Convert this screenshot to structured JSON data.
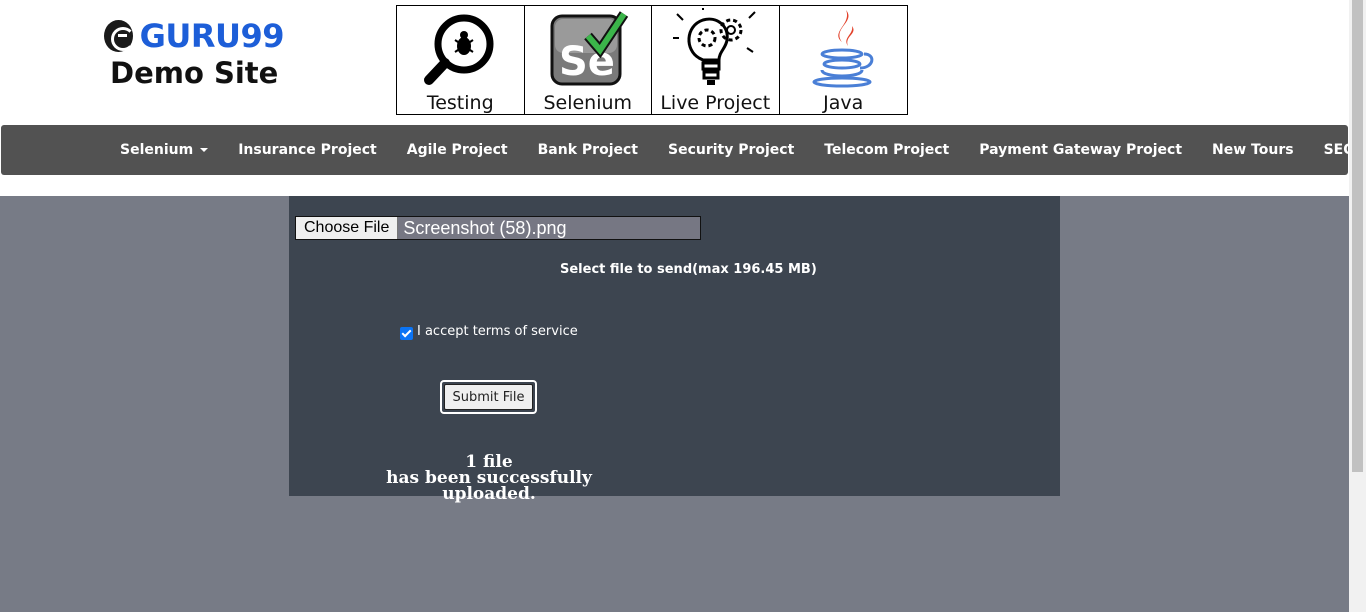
{
  "logo": {
    "name": "GURU99",
    "subtitle": "Demo Site"
  },
  "tiles": [
    {
      "label": "Testing",
      "icon": "magnifier-bug-icon"
    },
    {
      "label": "Selenium",
      "icon": "selenium-check-icon"
    },
    {
      "label": "Live Project",
      "icon": "lightbulb-gears-icon"
    },
    {
      "label": "Java",
      "icon": "java-cup-icon"
    }
  ],
  "nav": {
    "items": [
      {
        "label": "Selenium",
        "dropdown": true
      },
      {
        "label": "Insurance Project"
      },
      {
        "label": "Agile Project"
      },
      {
        "label": "Bank Project"
      },
      {
        "label": "Security Project"
      },
      {
        "label": "Telecom Project"
      },
      {
        "label": "Payment Gateway Project"
      },
      {
        "label": "New Tours"
      },
      {
        "label": "SEO",
        "dropdown": true
      }
    ]
  },
  "upload": {
    "choose_label": "Choose File",
    "file_name": "Screenshot (58).png",
    "hint": "Select file to send(max 196.45 MB)",
    "accept_label": "I accept terms of service",
    "accept_checked": true,
    "submit_label": "Submit File",
    "result_line1": "1 file",
    "result_line2": "has been successfully uploaded."
  },
  "colors": {
    "brand": "#1d5ed8",
    "navbar": "#525252",
    "page_bg": "#777b86",
    "panel_bg": "#3d4550",
    "checkbox": "#0b74f5"
  }
}
